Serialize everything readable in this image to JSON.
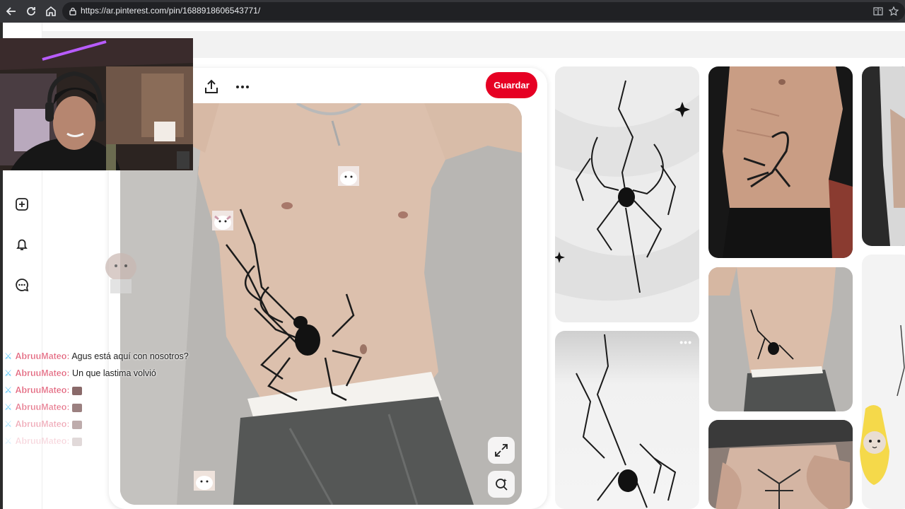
{
  "browser": {
    "url": "https://ar.pinterest.com/pin/1688918606543771/",
    "nav_icons": [
      "back-arrow-icon",
      "reload-icon",
      "home-icon"
    ],
    "right_icons": [
      "reader-mode-icon",
      "bookmark-star-icon"
    ]
  },
  "sidebar": {
    "icons": [
      "create-plus-icon",
      "notifications-bell-icon",
      "messages-icon"
    ]
  },
  "pin": {
    "toolbar_icons": [
      "share-icon",
      "more-options-icon"
    ],
    "save_label": "Guardar",
    "image_buttons": [
      "expand-icon",
      "visual-search-icon"
    ],
    "accent": "#e60023"
  },
  "chat": {
    "messages": [
      {
        "user": "AbruuMateo:",
        "text": " Agus está aquí con nosotros?"
      },
      {
        "user": "AbruuMateo:",
        "text": " Un que lastima volvió"
      },
      {
        "user": "AbruuMateo:",
        "text": ""
      },
      {
        "user": "AbruuMateo:",
        "text": ""
      },
      {
        "user": "AbruuMateo:",
        "text": ""
      },
      {
        "user": "AbruuMateo:",
        "text": ""
      }
    ]
  },
  "feed": {
    "more_label": "•••"
  }
}
